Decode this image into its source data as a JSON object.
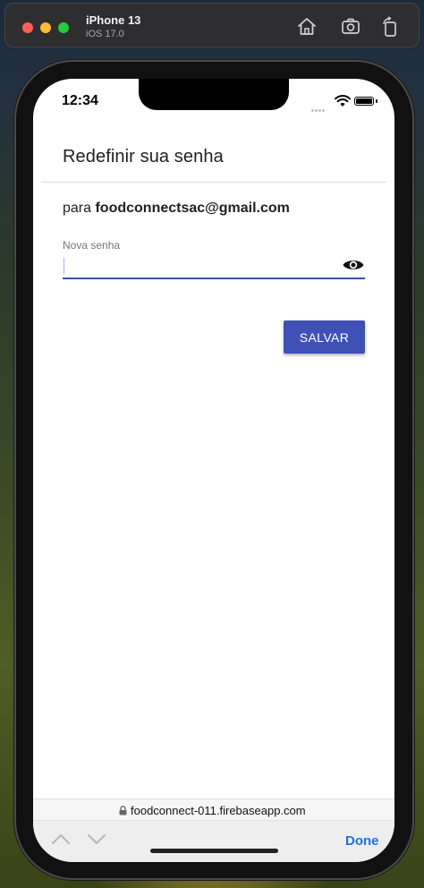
{
  "simulator": {
    "device_name": "iPhone 13",
    "os_version": "iOS 17.0",
    "icons": [
      "home-icon",
      "screenshot-icon",
      "rotate-icon"
    ]
  },
  "status_bar": {
    "time": "12:34"
  },
  "page": {
    "title": "Redefinir sua senha",
    "account_prefix": "para ",
    "account_email": "foodconnectsac@gmail.com",
    "password_label": "Nova senha",
    "password_value": "",
    "save_label": "SALVAR"
  },
  "browser": {
    "url": "foodconnect-011.firebaseapp.com",
    "done_label": "Done"
  },
  "colors": {
    "accent": "#3f51b5",
    "link": "#1a73e8"
  }
}
